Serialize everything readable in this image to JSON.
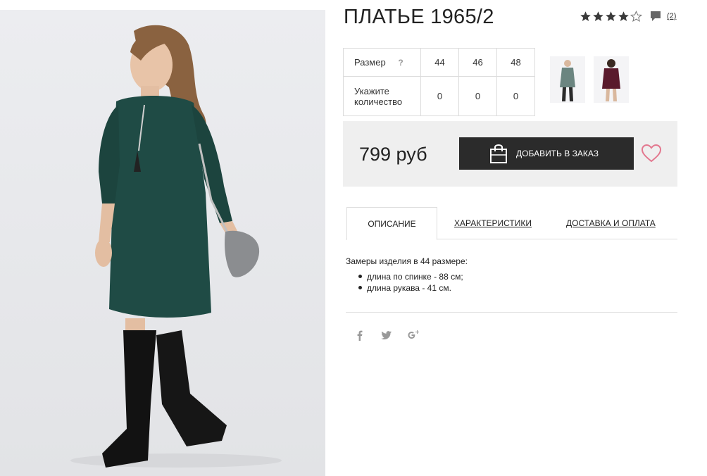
{
  "product": {
    "title": "ПЛАТЬЕ 1965/2",
    "rating_stars": 4,
    "rating_max": 5,
    "review_count": "(2)"
  },
  "sizes": {
    "size_label": "Размер",
    "help_label": "?",
    "quantity_label": "Укажите количество",
    "items": [
      {
        "size": "44",
        "quantity": "0"
      },
      {
        "size": "46",
        "quantity": "0"
      },
      {
        "size": "48",
        "quantity": "0"
      }
    ]
  },
  "thumbnails": [
    {
      "color_name": "green",
      "color": "#1f4b45"
    },
    {
      "color_name": "burgundy",
      "color": "#5a1a2c"
    }
  ],
  "purchase": {
    "price": "799 руб",
    "add_button_label": "ДОБАВИТЬ В ЗАКАЗ"
  },
  "tabs": [
    {
      "label": "ОПИСАНИЕ",
      "active": true
    },
    {
      "label": "ХАРАКТЕРИСТИКИ",
      "active": false
    },
    {
      "label": "ДОСТАВКА И ОПЛАТА",
      "active": false
    }
  ],
  "description": {
    "intro": "Замеры изделия в 44 размере:",
    "bullets": [
      "длина по спинке - 88 см;",
      "длина рукава - 41 см."
    ]
  },
  "social": [
    "facebook-icon",
    "twitter-icon",
    "google-plus-icon"
  ],
  "colors": {
    "accent_dark": "#2b2b2b",
    "heart": "#e3788f",
    "dress": "#1f4b45"
  }
}
